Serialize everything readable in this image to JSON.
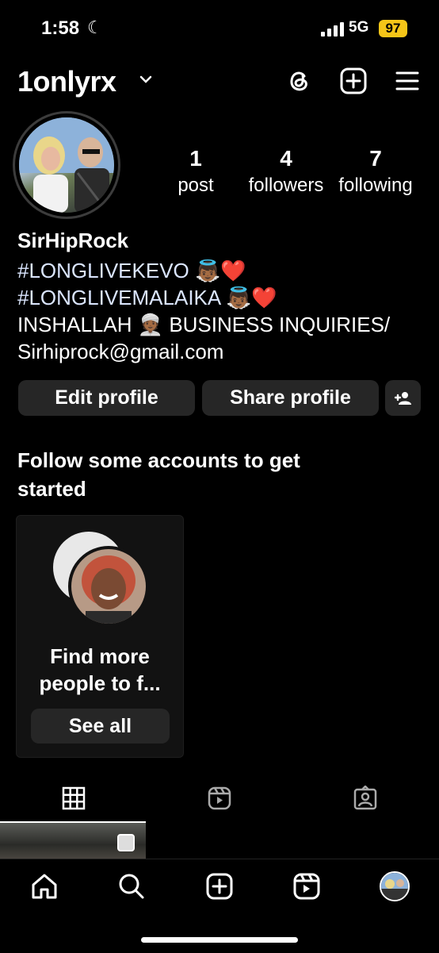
{
  "status_bar": {
    "time": "1:58",
    "network": "5G",
    "battery": "97"
  },
  "header": {
    "username": "1onlyrx"
  },
  "profile": {
    "stats": [
      {
        "num": "1",
        "label": "post"
      },
      {
        "num": "4",
        "label": "followers"
      },
      {
        "num": "7",
        "label": "following"
      }
    ],
    "display_name": "SirHipRock",
    "bio_lines": [
      "#LONGLIVEKEVO 👼🏾❤️",
      "#LONGLIVEMALAIKA 👼🏾❤️",
      "INSHALLAH 👳🏾 BUSINESS INQUIRIES/",
      "Sirhiprock@gmail.com"
    ]
  },
  "actions": {
    "edit": "Edit profile",
    "share": "Share profile"
  },
  "suggestions": {
    "title": "Follow some accounts to get started",
    "card_text": "Find more people to f...",
    "see_all": "See all"
  },
  "icons": [
    "threads-icon",
    "create-post-icon",
    "menu-icon",
    "add-person-icon",
    "grid-icon",
    "reels-icon",
    "tagged-icon",
    "home-icon",
    "search-icon",
    "create-icon",
    "reels-nav-icon"
  ]
}
